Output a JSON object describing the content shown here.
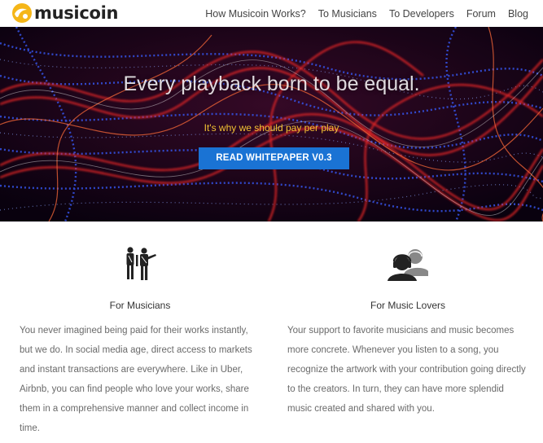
{
  "logo": {
    "text": "musicoin",
    "icon": "musicoin-logo-icon",
    "color": "#f5b618"
  },
  "nav": {
    "links": [
      "How Musicoin Works?",
      "To Musicians",
      "To Developers",
      "Forum",
      "Blog"
    ]
  },
  "hero": {
    "title": "Every playback born to be equal.",
    "subtitle": "It's why we should pay per play",
    "button_label": "READ WHITEPAPER V0.3",
    "button_color": "#1a73d4",
    "subtitle_color": "#f2c233"
  },
  "features": [
    {
      "icon": "musicians-icon",
      "title": "For Musicians",
      "text": "You never imagined being paid for their works instantly, but we do. In social media age, direct access to markets and instant transactions are everywhere. Like in Uber, Airbnb, you can find people who love your works, share them in a comprehensive manner and collect income in time."
    },
    {
      "icon": "music-lovers-icon",
      "title": "For Music Lovers",
      "text": "Your support to favorite musicians and music becomes more concrete. Whenever you listen to a song, you recognize the artwork with your contribution going directly to the creators. In turn, they can have more splendid music created and shared with you."
    }
  ]
}
